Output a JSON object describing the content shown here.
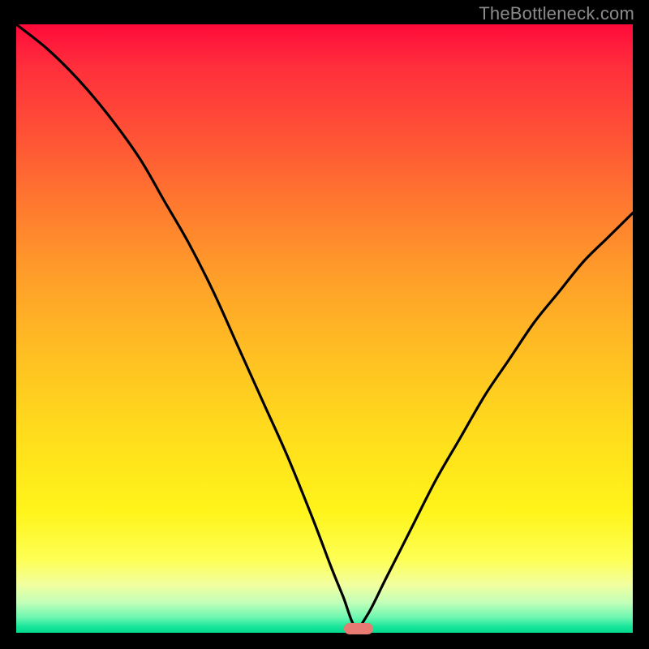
{
  "watermark": "TheBottleneck.com",
  "colors": {
    "frame": "#000000",
    "curve": "#000000",
    "marker": "#e77a72",
    "gradient_top": "#ff0a3a",
    "gradient_bottom": "#00d98d"
  },
  "chart_data": {
    "type": "line",
    "title": "",
    "xlabel": "",
    "ylabel": "",
    "xlim": [
      0,
      100
    ],
    "ylim": [
      0,
      100
    ],
    "grid": false,
    "legend": false,
    "annotations": [
      {
        "kind": "marker-pill",
        "x": 55.5,
        "y": 0.7
      }
    ],
    "series": [
      {
        "name": "bottleneck-curve",
        "x": [
          0,
          5,
          10,
          15,
          20,
          24,
          28,
          32,
          36,
          40,
          44,
          48,
          51,
          53,
          55,
          57,
          60,
          64,
          68,
          72,
          76,
          80,
          84,
          88,
          92,
          96,
          100
        ],
        "y": [
          100,
          96,
          91,
          85,
          78,
          71,
          64,
          56,
          47,
          38,
          29,
          19,
          11,
          6,
          1,
          3,
          9,
          17,
          25,
          32,
          39,
          45,
          51,
          56,
          61,
          65,
          69
        ]
      }
    ]
  }
}
